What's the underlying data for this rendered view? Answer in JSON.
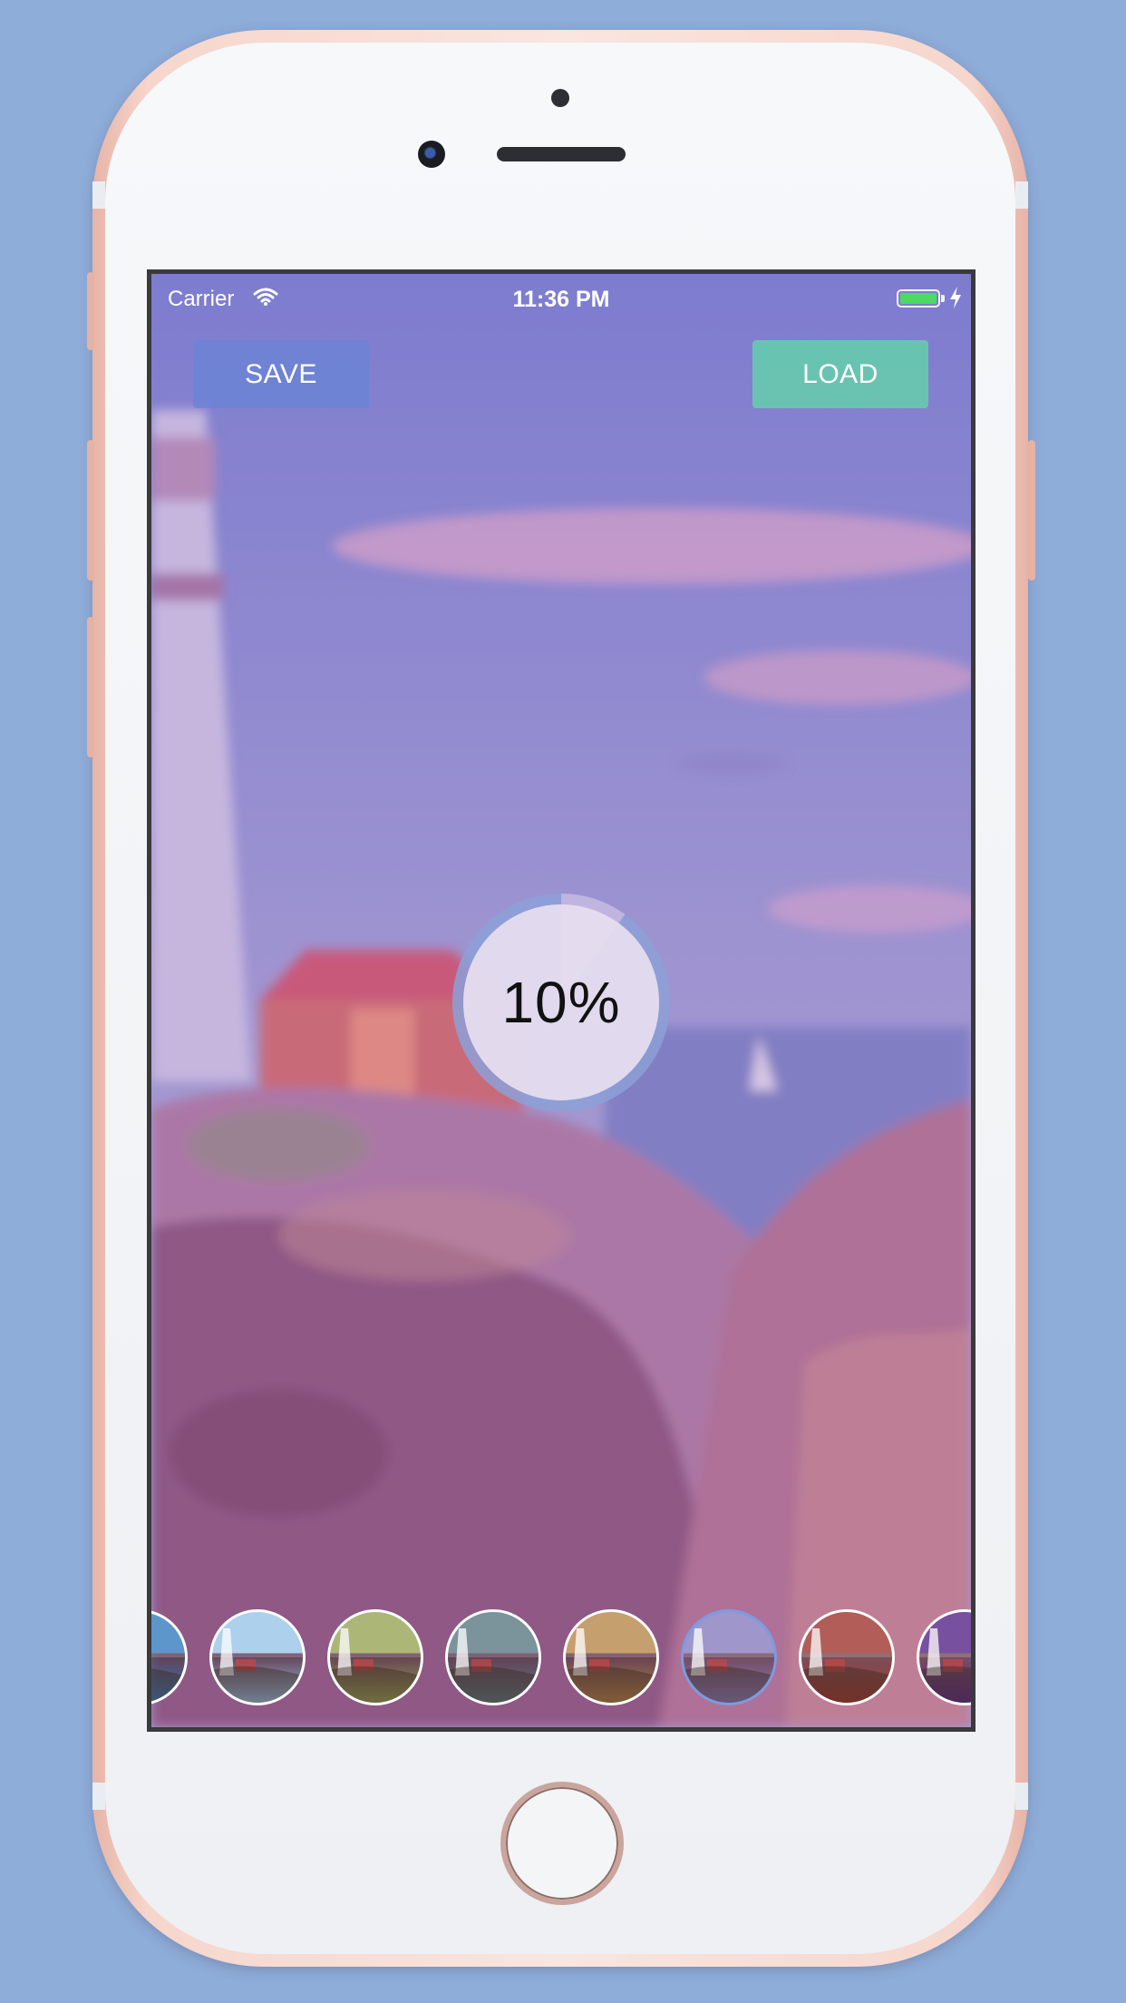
{
  "status_bar": {
    "carrier": "Carrier",
    "time": "11:36 PM",
    "battery_color": "#4cd964"
  },
  "toolbar": {
    "save_label": "SAVE",
    "load_label": "LOAD"
  },
  "progress": {
    "label": "10%",
    "value": 0.1
  },
  "filters": {
    "selected_index": 5,
    "items": [
      {
        "name": "filter-1",
        "tint": "#3a7fc0"
      },
      {
        "name": "filter-2",
        "tint": "#9cc6e8"
      },
      {
        "name": "filter-3",
        "tint": "#9aa85a"
      },
      {
        "name": "filter-4",
        "tint": "#5e7c86"
      },
      {
        "name": "filter-5",
        "tint": "#b98a4e"
      },
      {
        "name": "filter-6",
        "tint": "#8a7fc0"
      },
      {
        "name": "filter-7",
        "tint": "#a13a32"
      },
      {
        "name": "filter-8",
        "tint": "#5a2a8a"
      }
    ]
  },
  "colors": {
    "background": "#8fadd9",
    "save_button": "#6a84d6",
    "load_button": "#68c7b0",
    "progress_ring": "#8fa6d8"
  }
}
